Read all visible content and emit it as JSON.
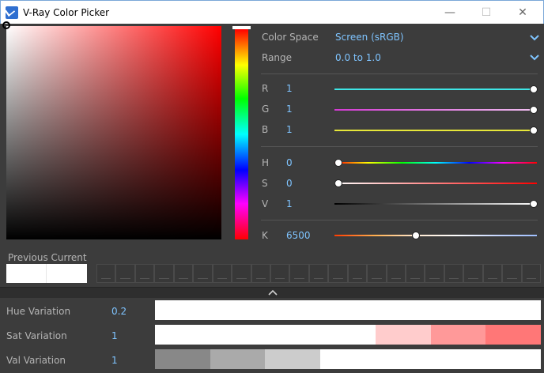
{
  "window": {
    "title": "V-Ray Color Picker",
    "minimize_glyph": "—",
    "maximize_glyph": "☐",
    "close_glyph": "✕"
  },
  "color_space": {
    "label": "Color Space",
    "value": "Screen (sRGB)"
  },
  "range": {
    "label": "Range",
    "value": "0.0 to 1.0"
  },
  "rgb": [
    {
      "label": "R",
      "value": "1",
      "level": 1.0
    },
    {
      "label": "G",
      "value": "1",
      "level": 1.0
    },
    {
      "label": "B",
      "value": "1",
      "level": 1.0
    }
  ],
  "hsv": [
    {
      "label": "H",
      "value": "0",
      "level": 0.0
    },
    {
      "label": "S",
      "value": "0",
      "level": 0.0
    },
    {
      "label": "V",
      "value": "1",
      "level": 1.0
    }
  ],
  "kelvin": {
    "label": "K",
    "value": "6500",
    "level": 0.4
  },
  "swatches": {
    "previous_label": "Previous",
    "current_label": "Current",
    "previous_color": "#ffffff",
    "current_color": "#ffffff",
    "custom_slot_count": 23
  },
  "variations": [
    {
      "label": "Hue Variation",
      "value": "0.2",
      "swatches": [
        "#ffffff",
        "#ffffff",
        "#ffffff",
        "#ffffff",
        "#ffffff",
        "#ffffff",
        "#ffffff"
      ]
    },
    {
      "label": "Sat Variation",
      "value": "1",
      "swatches": [
        "#ffffff",
        "#ffffff",
        "#ffffff",
        "#ffffff",
        "#ffcccc",
        "#ff9999",
        "#ff7777"
      ]
    },
    {
      "label": "Val Variation",
      "value": "1",
      "swatches": [
        "#888888",
        "#aaaaaa",
        "#cccccc",
        "#ffffff",
        "#ffffff",
        "#ffffff",
        "#ffffff"
      ]
    }
  ],
  "colors": {
    "accent": "#7fc4ff",
    "background": "#3c3c3c",
    "r_track": "#3ee6e6",
    "g_track": "#e24be2",
    "b_track": "#e6e63a"
  }
}
